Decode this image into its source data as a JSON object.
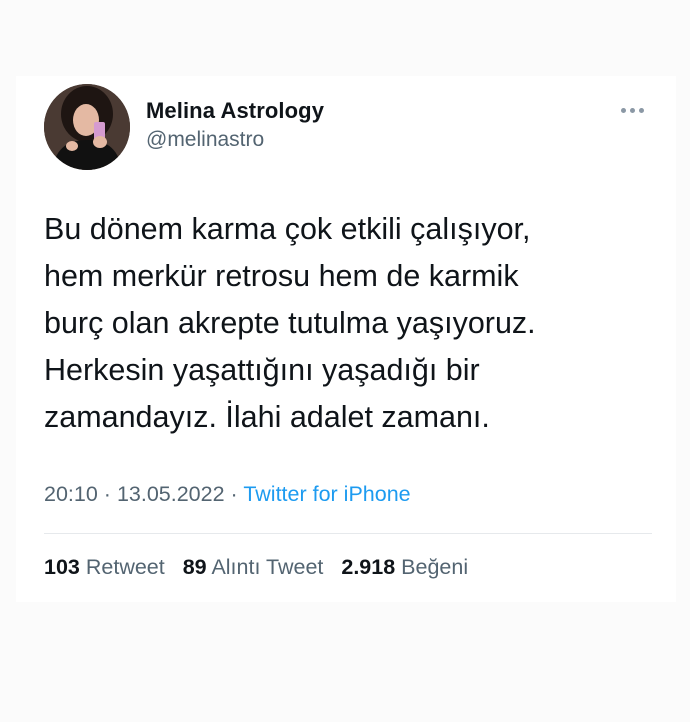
{
  "user": {
    "display_name": "Melina Astrology",
    "handle": "@melinastro"
  },
  "tweet": {
    "lines": [
      "Bu dönem karma çok etkili çalışıyor,",
      "hem merkür retrosu hem de karmik",
      "burç olan akrepte tutulma yaşıyoruz.",
      "Herkesin yaşattığını yaşadığı bir",
      "zamandayız. İlahi adalet zamanı."
    ],
    "time": "20:10",
    "date": "13.05.2022",
    "separator": "·",
    "source": "Twitter for iPhone"
  },
  "stats": {
    "retweets_count": "103",
    "retweets_label": "Retweet",
    "quotes_count": "89",
    "quotes_label": "Alıntı Tweet",
    "likes_count": "2.918",
    "likes_label": "Beğeni"
  },
  "icons": {
    "more": "more-horizontal-icon"
  },
  "colors": {
    "text": "#0f1419",
    "secondary": "#536471",
    "link": "#1d9bf0",
    "divider": "#e6e9ec"
  }
}
